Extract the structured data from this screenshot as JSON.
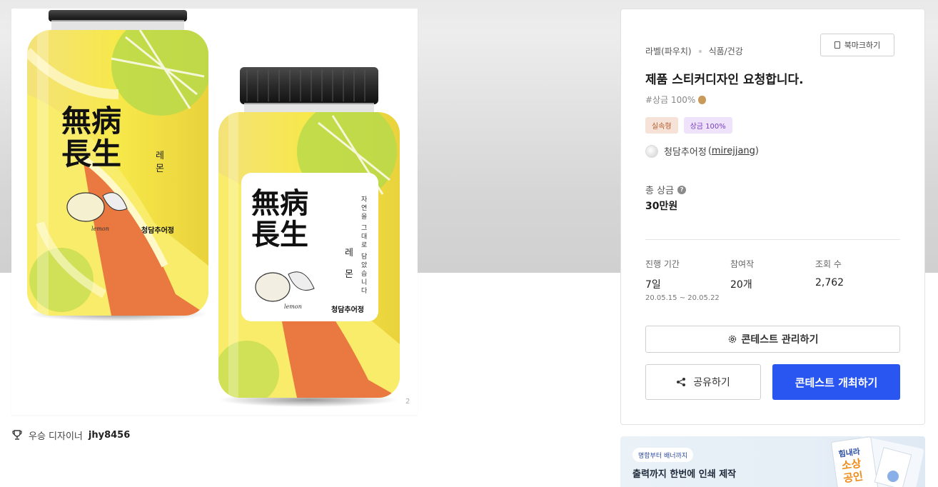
{
  "gallery": {
    "image_alt": "무병장생 레몬 병 스티커 디자인",
    "label_big": [
      "無病",
      "長生"
    ],
    "label_vertical_1": "자연을 그대로 담았습니다",
    "label_vertical_2": "레 몬",
    "label_brand": "청담추어정",
    "label_script": "lemon",
    "image_counter": "2"
  },
  "winner": {
    "label": "우승 디자이너",
    "username": "jhy8456",
    "icon": "trophy-icon"
  },
  "contest": {
    "category_1": "라벨(파우치)",
    "category_2": "식품/건강",
    "bookmark_label": "북마크하기",
    "title": "제품 스티커디자인 요청합니다.",
    "prize_tag": "#상금 100%",
    "badges": [
      "실속형",
      "상금 100%"
    ],
    "host_name": "청담추어정",
    "host_id": "mirejjang",
    "total_prize_label": "총 상금",
    "total_prize_value": "30만원",
    "stats": {
      "period_label": "진행 기간",
      "period_value": "7일",
      "period_dates": "20.05.15 ~ 20.05.22",
      "entries_label": "참여작",
      "entries_value": "20개",
      "views_label": "조회 수",
      "views_value": "2,762"
    },
    "manage_label": "콘테스트 관리하기",
    "share_label": "공유하기",
    "host_contest_label": "콘테스트 개최하기"
  },
  "banner": {
    "pill": "명함부터 배너까지",
    "text": "출력까지 한번에 인쇄 제작",
    "art_text": [
      "힘내라",
      "소상",
      "공인"
    ]
  },
  "colors": {
    "primary": "#2956f0",
    "badge_practical_bg": "#f6e2d7",
    "badge_prize_bg": "#eee3fa"
  }
}
